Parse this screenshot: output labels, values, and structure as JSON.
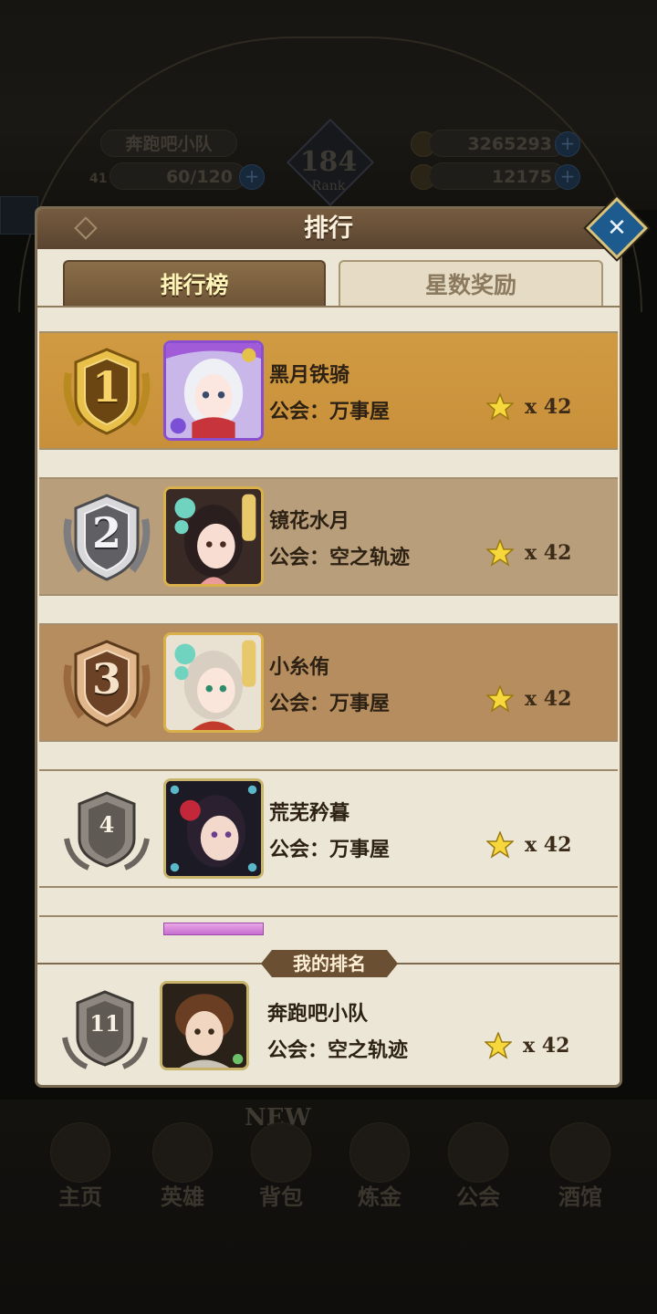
{
  "background": {
    "team_name": "奔跑吧小队",
    "stamina": "60/120",
    "level_prefix": "41",
    "gold": "3265293",
    "gems": "12175",
    "rank_value": "184",
    "rank_label": "Rank",
    "new_badge": "NEW",
    "nav": [
      {
        "label": "主页",
        "icon": "castle-icon"
      },
      {
        "label": "英雄",
        "icon": "helmet-icon"
      },
      {
        "label": "背包",
        "icon": "bag-icon"
      },
      {
        "label": "炼金",
        "icon": "flask-icon"
      },
      {
        "label": "公会",
        "icon": "guild-shield-icon"
      },
      {
        "label": "酒馆",
        "icon": "tavern-icon"
      }
    ]
  },
  "panel": {
    "title": "排行",
    "tabs": [
      {
        "label": "排行榜",
        "active": true
      },
      {
        "label": "星数奖励",
        "active": false
      }
    ]
  },
  "rankings": [
    {
      "rank": "1",
      "name": "黑月铁骑",
      "guild": "公会：万事屋",
      "stars": "x 42"
    },
    {
      "rank": "2",
      "name": "镜花水月",
      "guild": "公会：空之轨迹",
      "stars": "x 42"
    },
    {
      "rank": "3",
      "name": "小糸侑",
      "guild": "公会：万事屋",
      "stars": "x 42"
    },
    {
      "rank": "4",
      "name": "荒芜矜暮",
      "guild": "公会：万事屋",
      "stars": "x 42"
    }
  ],
  "my_rank": {
    "section_label": "我的排名",
    "rank": "11",
    "name": "奔跑吧小队",
    "guild": "公会：空之轨迹",
    "stars": "x 42"
  },
  "colors": {
    "gold_row": "#c8903a",
    "silver_row": "#b89e7a",
    "bronze_row": "#b68d5e",
    "panel_bg": "#ece6d7",
    "header_brown": "#5a4431",
    "close_blue": "#1d5a8e"
  }
}
